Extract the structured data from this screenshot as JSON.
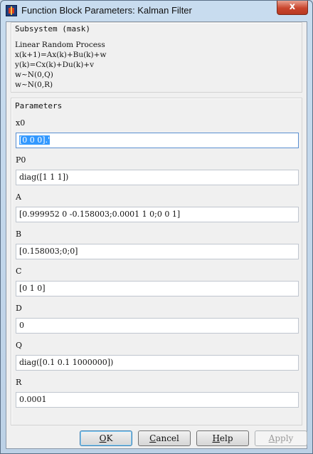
{
  "window": {
    "title": "Function Block Parameters: Kalman Filter",
    "close_glyph": "x"
  },
  "mask": {
    "group_label": "Subsystem (mask)",
    "description": [
      "Linear Random Process",
      "x(k+1)=Ax(k)+Bu(k)+w",
      "y(k)=Cx(k)+Du(k)+v",
      "w~N(0,Q)",
      "w~N(0,R)"
    ]
  },
  "parameters": {
    "group_label": "Parameters",
    "fields": [
      {
        "label": "x0",
        "value": "[0 0 0].'"
      },
      {
        "label": "P0",
        "value": "diag([1 1 1])"
      },
      {
        "label": "A",
        "value": "[0.999952 0 -0.158003;0.0001 1 0;0 0 1]"
      },
      {
        "label": "B",
        "value": "[0.158003;0;0]"
      },
      {
        "label": "C",
        "value": "[0 1 0]"
      },
      {
        "label": "D",
        "value": "0"
      },
      {
        "label": "Q",
        "value": "diag([0.1 0.1 1000000])"
      },
      {
        "label": "R",
        "value": "0.0001"
      }
    ]
  },
  "buttons": {
    "ok": {
      "mnemonic": "O",
      "rest": "K"
    },
    "cancel": {
      "mnemonic": "C",
      "rest": "ancel"
    },
    "help": {
      "mnemonic": "H",
      "rest": "elp"
    },
    "apply": {
      "mnemonic": "A",
      "rest": "pply",
      "enabled": false
    }
  }
}
